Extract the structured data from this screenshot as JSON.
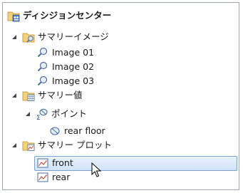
{
  "tree": {
    "root": {
      "label": "ディシジョンセンター",
      "icon": "decision-center-folder-icon"
    },
    "groups": [
      {
        "label": "サマリーイメージ",
        "icon": "summary-image-folder-icon",
        "expanded": true,
        "items": [
          {
            "label": "Image 01",
            "icon": "image-probe-icon"
          },
          {
            "label": "Image 02",
            "icon": "image-probe-icon"
          },
          {
            "label": "Image 03",
            "icon": "image-probe-icon"
          }
        ]
      },
      {
        "label": "サマリー値",
        "icon": "summary-value-folder-icon",
        "expanded": true,
        "subgroup": {
          "label": "ポイント",
          "icon": "point-sigma-icon",
          "expanded": true,
          "items": [
            {
              "label": "rear floor",
              "icon": "point-probe-icon"
            }
          ]
        }
      },
      {
        "label": "サマリー プロット",
        "icon": "summary-plot-folder-icon",
        "expanded": true,
        "items": [
          {
            "label": "front",
            "icon": "plot-icon",
            "selected": true
          },
          {
            "label": "rear",
            "icon": "plot-icon",
            "selected": false
          }
        ]
      }
    ]
  },
  "colors": {
    "selection_border": "#7da2ce",
    "selection_fill": "#d9e9fb",
    "panel_border": "#9ea7b1",
    "folder": "#f3d37a"
  }
}
